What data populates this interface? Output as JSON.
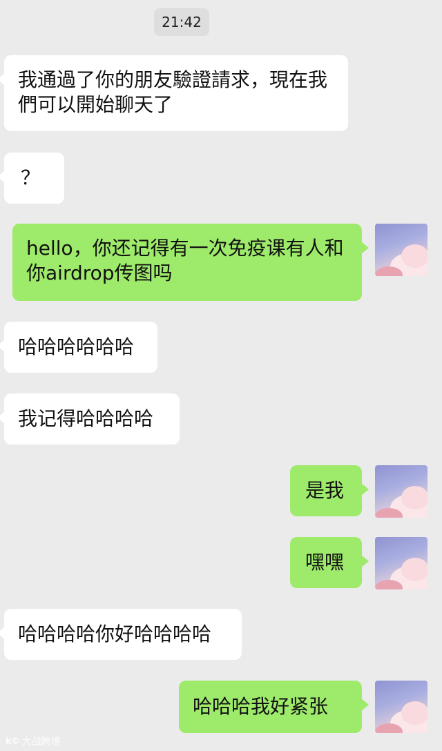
{
  "time": "21:42",
  "messages": [
    {
      "side": "in",
      "text": "我通過了你的朋友驗證請求，現在我們可以開始聊天了"
    },
    {
      "side": "in",
      "text": "？"
    },
    {
      "side": "out",
      "text": "hello，你还记得有一次免疫课有人和你airdrop传图吗"
    },
    {
      "side": "in",
      "text": "哈哈哈哈哈哈"
    },
    {
      "side": "in",
      "text": "我记得哈哈哈哈"
    },
    {
      "side": "out",
      "text": "是我"
    },
    {
      "side": "out",
      "text": "嘿嘿"
    },
    {
      "side": "in",
      "text": "哈哈哈哈你好哈哈哈哈"
    },
    {
      "side": "out",
      "text": "哈哈哈我好紧张"
    }
  ],
  "watermark": {
    "logo": "k©",
    "text": "大战跨境"
  },
  "colors": {
    "background": "#ebebeb",
    "incoming_bubble": "#ffffff",
    "outgoing_bubble": "#9eea6a"
  }
}
